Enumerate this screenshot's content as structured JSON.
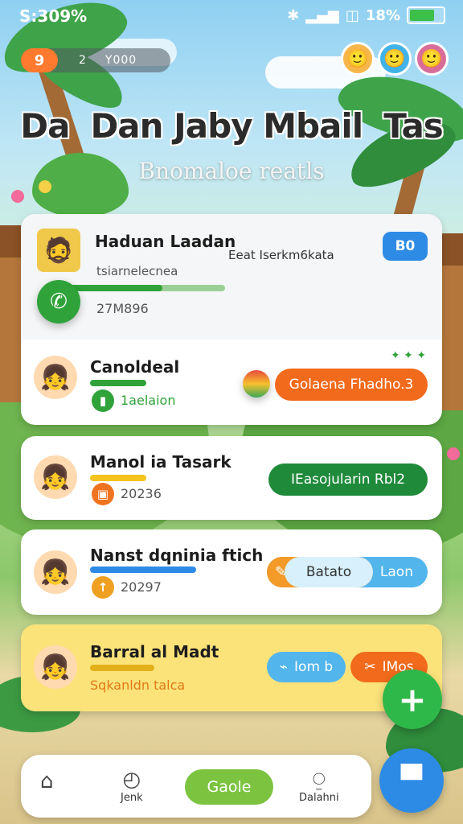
{
  "status": {
    "time": "S:309%",
    "battery": "18%",
    "icons": [
      "bluetooth-icon",
      "signal-icon",
      "wifi-icon",
      "battery-icon"
    ]
  },
  "header": {
    "pill_logo": "9",
    "pill_num": "2",
    "pill_value": "Y000",
    "title": "Dan Jaby Mbail",
    "title_left": "Da",
    "title_right": "Tas",
    "subtitle": "Bnomaloe reatls"
  },
  "cards": [
    {
      "name": "Haduan Laadan",
      "line1": "Eeat Iserkm6kata",
      "line2": "tsiarnelecnea",
      "meta": "27M896",
      "badge": "B0",
      "accent": "#2f9a3a"
    },
    {
      "name": "Canoldeal",
      "meta": "1aelaion",
      "action": "Golaena Fhadho.3",
      "accent": "#f07420"
    },
    {
      "name": "Manol ia Tasark",
      "meta": "20236",
      "action": "IEasojularin Rbl2",
      "accent": "#1f8a3a"
    },
    {
      "name": "Nanst dqninia ftich",
      "meta": "20297",
      "action_left": "Batato",
      "action_right": "Laon",
      "accent": "#3aa0e6"
    },
    {
      "name": "Barral al Madt",
      "meta": "Sqkanldn talca",
      "action_left": "Iom b",
      "action_right": "IMos",
      "accent": "#f4c31d"
    }
  ],
  "nav": {
    "item1": "",
    "item2": "Jenk",
    "center": "Gaole",
    "item4": "Dalahni"
  },
  "colors": {
    "green": "#2fa33a",
    "orange": "#f26a1b",
    "blue": "#2d8be6"
  }
}
